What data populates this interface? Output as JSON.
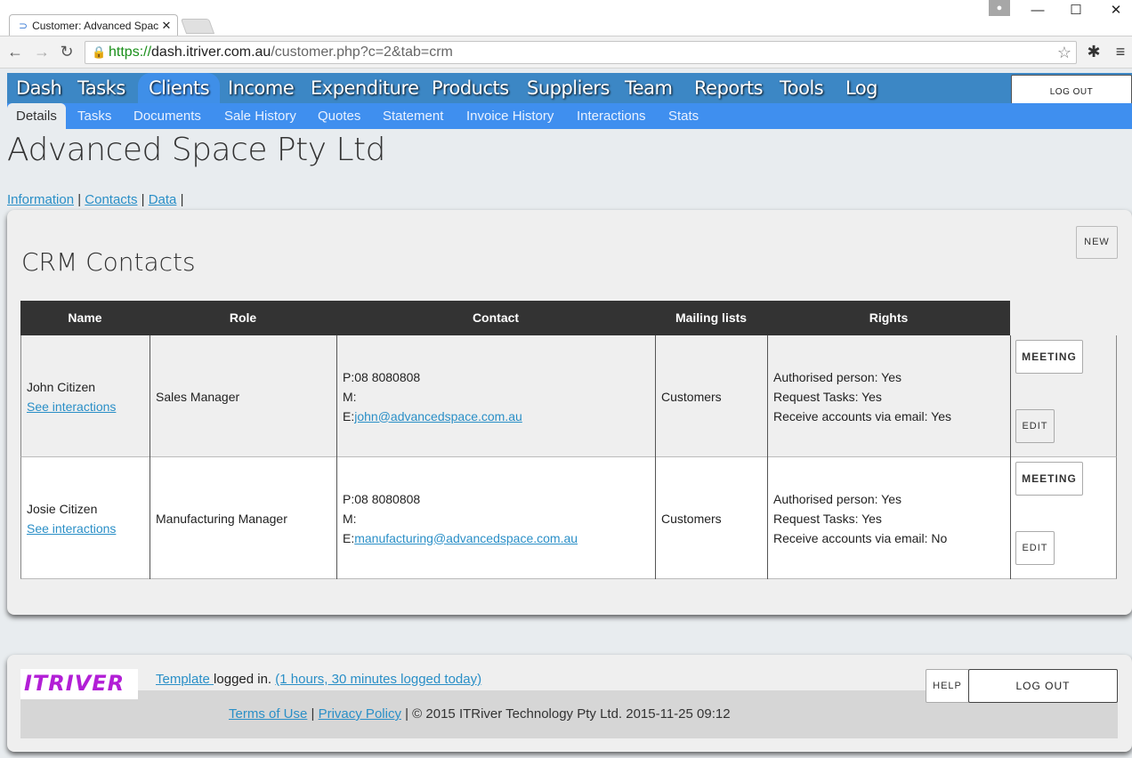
{
  "browser": {
    "tab_title": "Customer: Advanced Spac",
    "url_secure": "https://",
    "url_host": "dash.itriver.com.au",
    "url_path": "/customer.php?c=2&tab=crm"
  },
  "mainnav": {
    "items": [
      "Dash",
      "Tasks",
      "Clients",
      "Income",
      "Expenditure",
      "Products",
      "Suppliers",
      "Team",
      "Reports",
      "Tools",
      "Log"
    ],
    "active": "Clients",
    "logout": "LOG OUT"
  },
  "subnav": {
    "items": [
      "Details",
      "Tasks",
      "Documents",
      "Sale History",
      "Quotes",
      "Statement",
      "Invoice History",
      "Interactions",
      "Stats"
    ],
    "active": "Details"
  },
  "company_name": "Advanced Space Pty Ltd",
  "sublinks": [
    "Information",
    "Contacts",
    "Data"
  ],
  "crm": {
    "title": "CRM Contacts",
    "new_button": "NEW",
    "headers": [
      "Name",
      "Role",
      "Contact",
      "Mailing lists",
      "Rights"
    ],
    "rows": [
      {
        "name": "John Citizen",
        "interactions": "See interactions",
        "role": "Sales Manager",
        "phone": "P:08 8080808",
        "mobile": "M:",
        "email_prefix": "E:",
        "email": "john@advancedspace.com.au",
        "mailing": "Customers",
        "rights": [
          "Authorised person: Yes",
          "Request Tasks: Yes",
          "Receive accounts via email: Yes"
        ],
        "meeting": "MEETING",
        "edit": "EDIT"
      },
      {
        "name": "Josie Citizen",
        "interactions": "See interactions",
        "role": "Manufacturing Manager",
        "phone": "P:08 8080808",
        "mobile": "M:",
        "email_prefix": "E:",
        "email": "manufacturing@advancedspace.com.au",
        "mailing": "Customers",
        "rights": [
          "Authorised person: Yes",
          "Request Tasks: Yes",
          "Receive accounts via email: No"
        ],
        "meeting": "MEETING",
        "edit": "EDIT"
      }
    ]
  },
  "footer": {
    "logo_text": "ITRIVER",
    "template_link": "Template ",
    "logged_in": "logged in. ",
    "logged_time": "(1 hours, 30 minutes logged today)",
    "help": "HELP",
    "logout": "LOG OUT",
    "terms": "Terms of Use",
    "privacy": "Privacy Policy",
    "copyright": " | © 2015 ITRiver Technology Pty Ltd. 2015-11-25 09:12"
  },
  "colors": {
    "mainnav_bg": "#3c87c5",
    "subnav_bg": "#3f8fef",
    "link": "#2a8fc7",
    "table_header": "#333333"
  }
}
